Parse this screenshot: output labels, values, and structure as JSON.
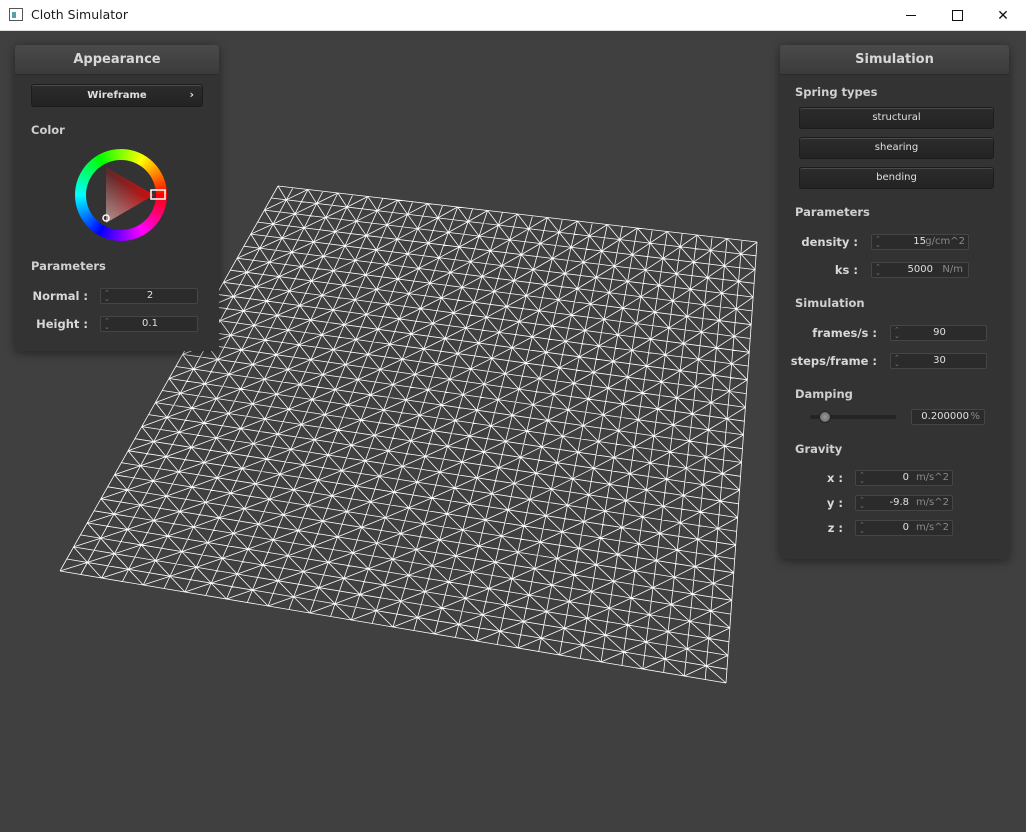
{
  "window": {
    "title": "Cloth Simulator",
    "minimize": "–",
    "maximize": "□",
    "close": "✕"
  },
  "appearance": {
    "title": "Appearance",
    "shader_select": {
      "value": "Wireframe",
      "arrow": "›"
    },
    "color_label": "Color",
    "color": "#c01010",
    "parameters_label": "Parameters",
    "normal": {
      "label": "Normal :",
      "value": "2"
    },
    "height": {
      "label": "Height :",
      "value": "0.1"
    }
  },
  "simulation": {
    "title": "Simulation",
    "spring_types_label": "Spring types",
    "springs": [
      "structural",
      "shearing",
      "bending"
    ],
    "parameters_label": "Parameters",
    "density": {
      "label": "density :",
      "value": "15",
      "unit": "g/cm^2"
    },
    "ks": {
      "label": "ks :",
      "value": "5000",
      "unit": "N/m"
    },
    "simulation_label": "Simulation",
    "frames": {
      "label": "frames/s :",
      "value": "90"
    },
    "steps": {
      "label": "steps/frame :",
      "value": "30"
    },
    "damping_label": "Damping",
    "damping": {
      "value": "0.200000",
      "unit": "%",
      "slider_fraction": 0.16
    },
    "gravity_label": "Gravity",
    "gx": {
      "label": "x :",
      "value": "0",
      "unit": "m/s^2"
    },
    "gy": {
      "label": "y :",
      "value": "-9.8",
      "unit": "m/s^2"
    },
    "gz": {
      "label": "z :",
      "value": "0",
      "unit": "m/s^2"
    }
  },
  "cloth": {
    "mode": "wireframe",
    "grid_resolution": 32,
    "line_color": "#ffffff"
  },
  "icons": {
    "app": "app-window-icon",
    "spinner": "spinner-arrows-icon",
    "chevron": "chevron-right-icon"
  }
}
